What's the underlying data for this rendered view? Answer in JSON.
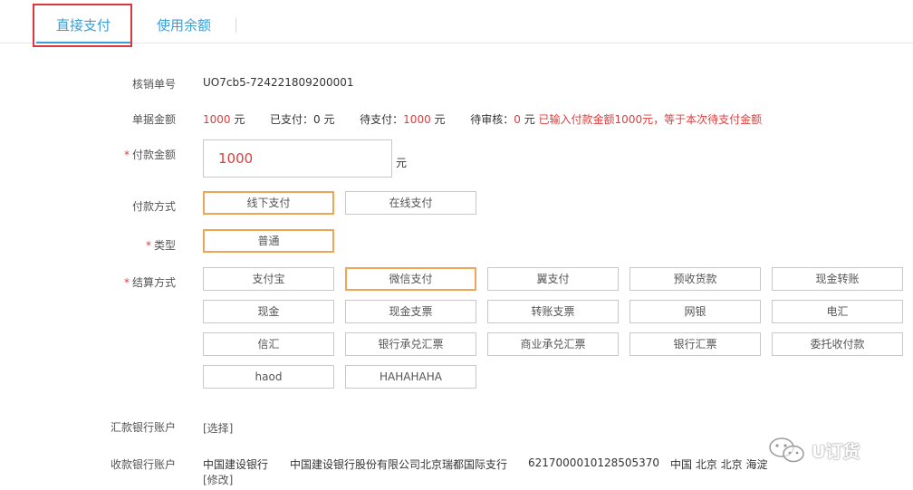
{
  "tabs": {
    "direct": "直接支付",
    "balance": "使用余额"
  },
  "order": {
    "label": "核销单号",
    "value": "UO7cb5-724221809200001"
  },
  "amounts": {
    "label": "单据金额",
    "total_value": "1000",
    "total_unit": "元",
    "paid": "已支付：0 元",
    "pending_label": "待支付：",
    "pending_value": "1000",
    "pending_unit": "元",
    "review_label": "待审核：",
    "review_value": "0",
    "review_unit": "元",
    "note": "已输入付款金额1000元，等于本次待支付金额"
  },
  "payment_amount": {
    "label": "付款金额",
    "value": "1000",
    "unit": "元"
  },
  "payment_method": {
    "label": "付款方式",
    "options": [
      "线下支付",
      "在线支付"
    ],
    "selected": "线下支付"
  },
  "type": {
    "label": "类型",
    "options": [
      "普通"
    ],
    "selected": "普通"
  },
  "settlement": {
    "label": "结算方式",
    "options": [
      "支付宝",
      "微信支付",
      "翼支付",
      "预收货款",
      "现金转账",
      "现金",
      "现金支票",
      "转账支票",
      "网银",
      "电汇",
      "信汇",
      "银行承兑汇票",
      "商业承兑汇票",
      "银行汇票",
      "委托收付款",
      "haod",
      "HAHAHAHA"
    ],
    "selected": "微信支付"
  },
  "remit_account": {
    "label": "汇款银行账户",
    "action": "[选择]"
  },
  "receive_account": {
    "label": "收款银行账户",
    "bank": "中国建设银行",
    "branch": "中国建设银行股份有限公司北京瑞都国际支行",
    "account_no": "6217000010128505370",
    "location": "中国 北京 北京 海淀",
    "action": "[修改]"
  },
  "watermark": {
    "text": "U订货",
    "icon": "wechat-icon"
  },
  "colors": {
    "accent": "#3a9fd6",
    "highlight": "#d9383e",
    "selected_border": "#f0a455",
    "alert_text": "#e03c3c"
  }
}
